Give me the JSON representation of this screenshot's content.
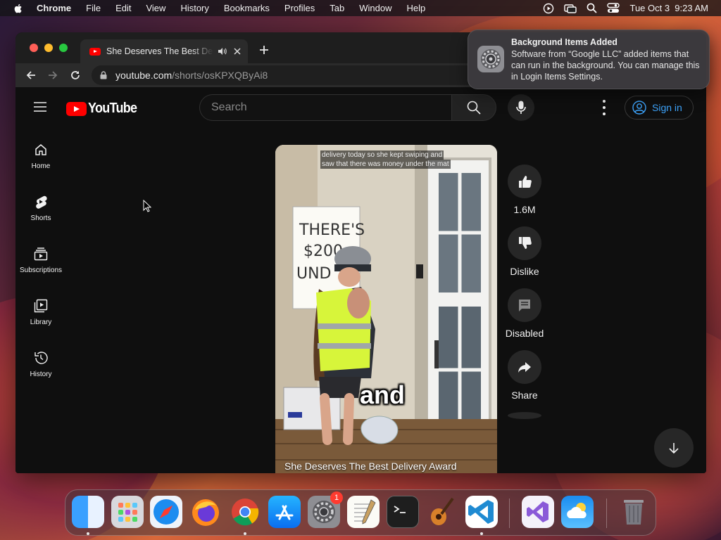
{
  "menubar": {
    "app": "Chrome",
    "items": [
      "File",
      "Edit",
      "View",
      "History",
      "Bookmarks",
      "Profiles",
      "Tab",
      "Window",
      "Help"
    ],
    "datetime": "Tue Oct 3  9:23 AM"
  },
  "browser": {
    "tab_title": "She Deserves The Best Delivery Award",
    "url_host": "youtube.com",
    "url_path": "/shorts/osKPXQByAi8"
  },
  "youtube": {
    "logo_text": "YouTube",
    "search_placeholder": "Search",
    "sign_in": "Sign in",
    "guide": [
      {
        "label": "Home",
        "icon": "home-icon"
      },
      {
        "label": "Shorts",
        "icon": "shorts-icon"
      },
      {
        "label": "Subscriptions",
        "icon": "subscriptions-icon"
      },
      {
        "label": "Library",
        "icon": "library-icon"
      },
      {
        "label": "History",
        "icon": "history-icon"
      }
    ],
    "video": {
      "caption_line1": "delivery today so she kept swiping and",
      "caption_line2": "saw that there was money under the mat",
      "overlay_word": "and",
      "title": "She Deserves The Best Delivery Award"
    },
    "actions": {
      "like_count": "1.6M",
      "dislike_label": "Dislike",
      "comments_label": "Disabled",
      "share_label": "Share"
    }
  },
  "notification": {
    "title": "Background Items Added",
    "body": "Software from “Google LLC” added items that can run in the background. You can manage this in Login Items Settings."
  },
  "dock": {
    "apps": [
      "finder",
      "launchpad",
      "safari",
      "firefox",
      "chrome",
      "app-store",
      "system-settings",
      "textedit",
      "terminal",
      "garageband",
      "vscode",
      "visual-studio",
      "weather",
      "trash"
    ],
    "settings_badge": "1"
  },
  "colors": {
    "youtube_red": "#ff0000",
    "link_blue": "#3ea6ff",
    "page_bg": "#0f0f0f"
  }
}
